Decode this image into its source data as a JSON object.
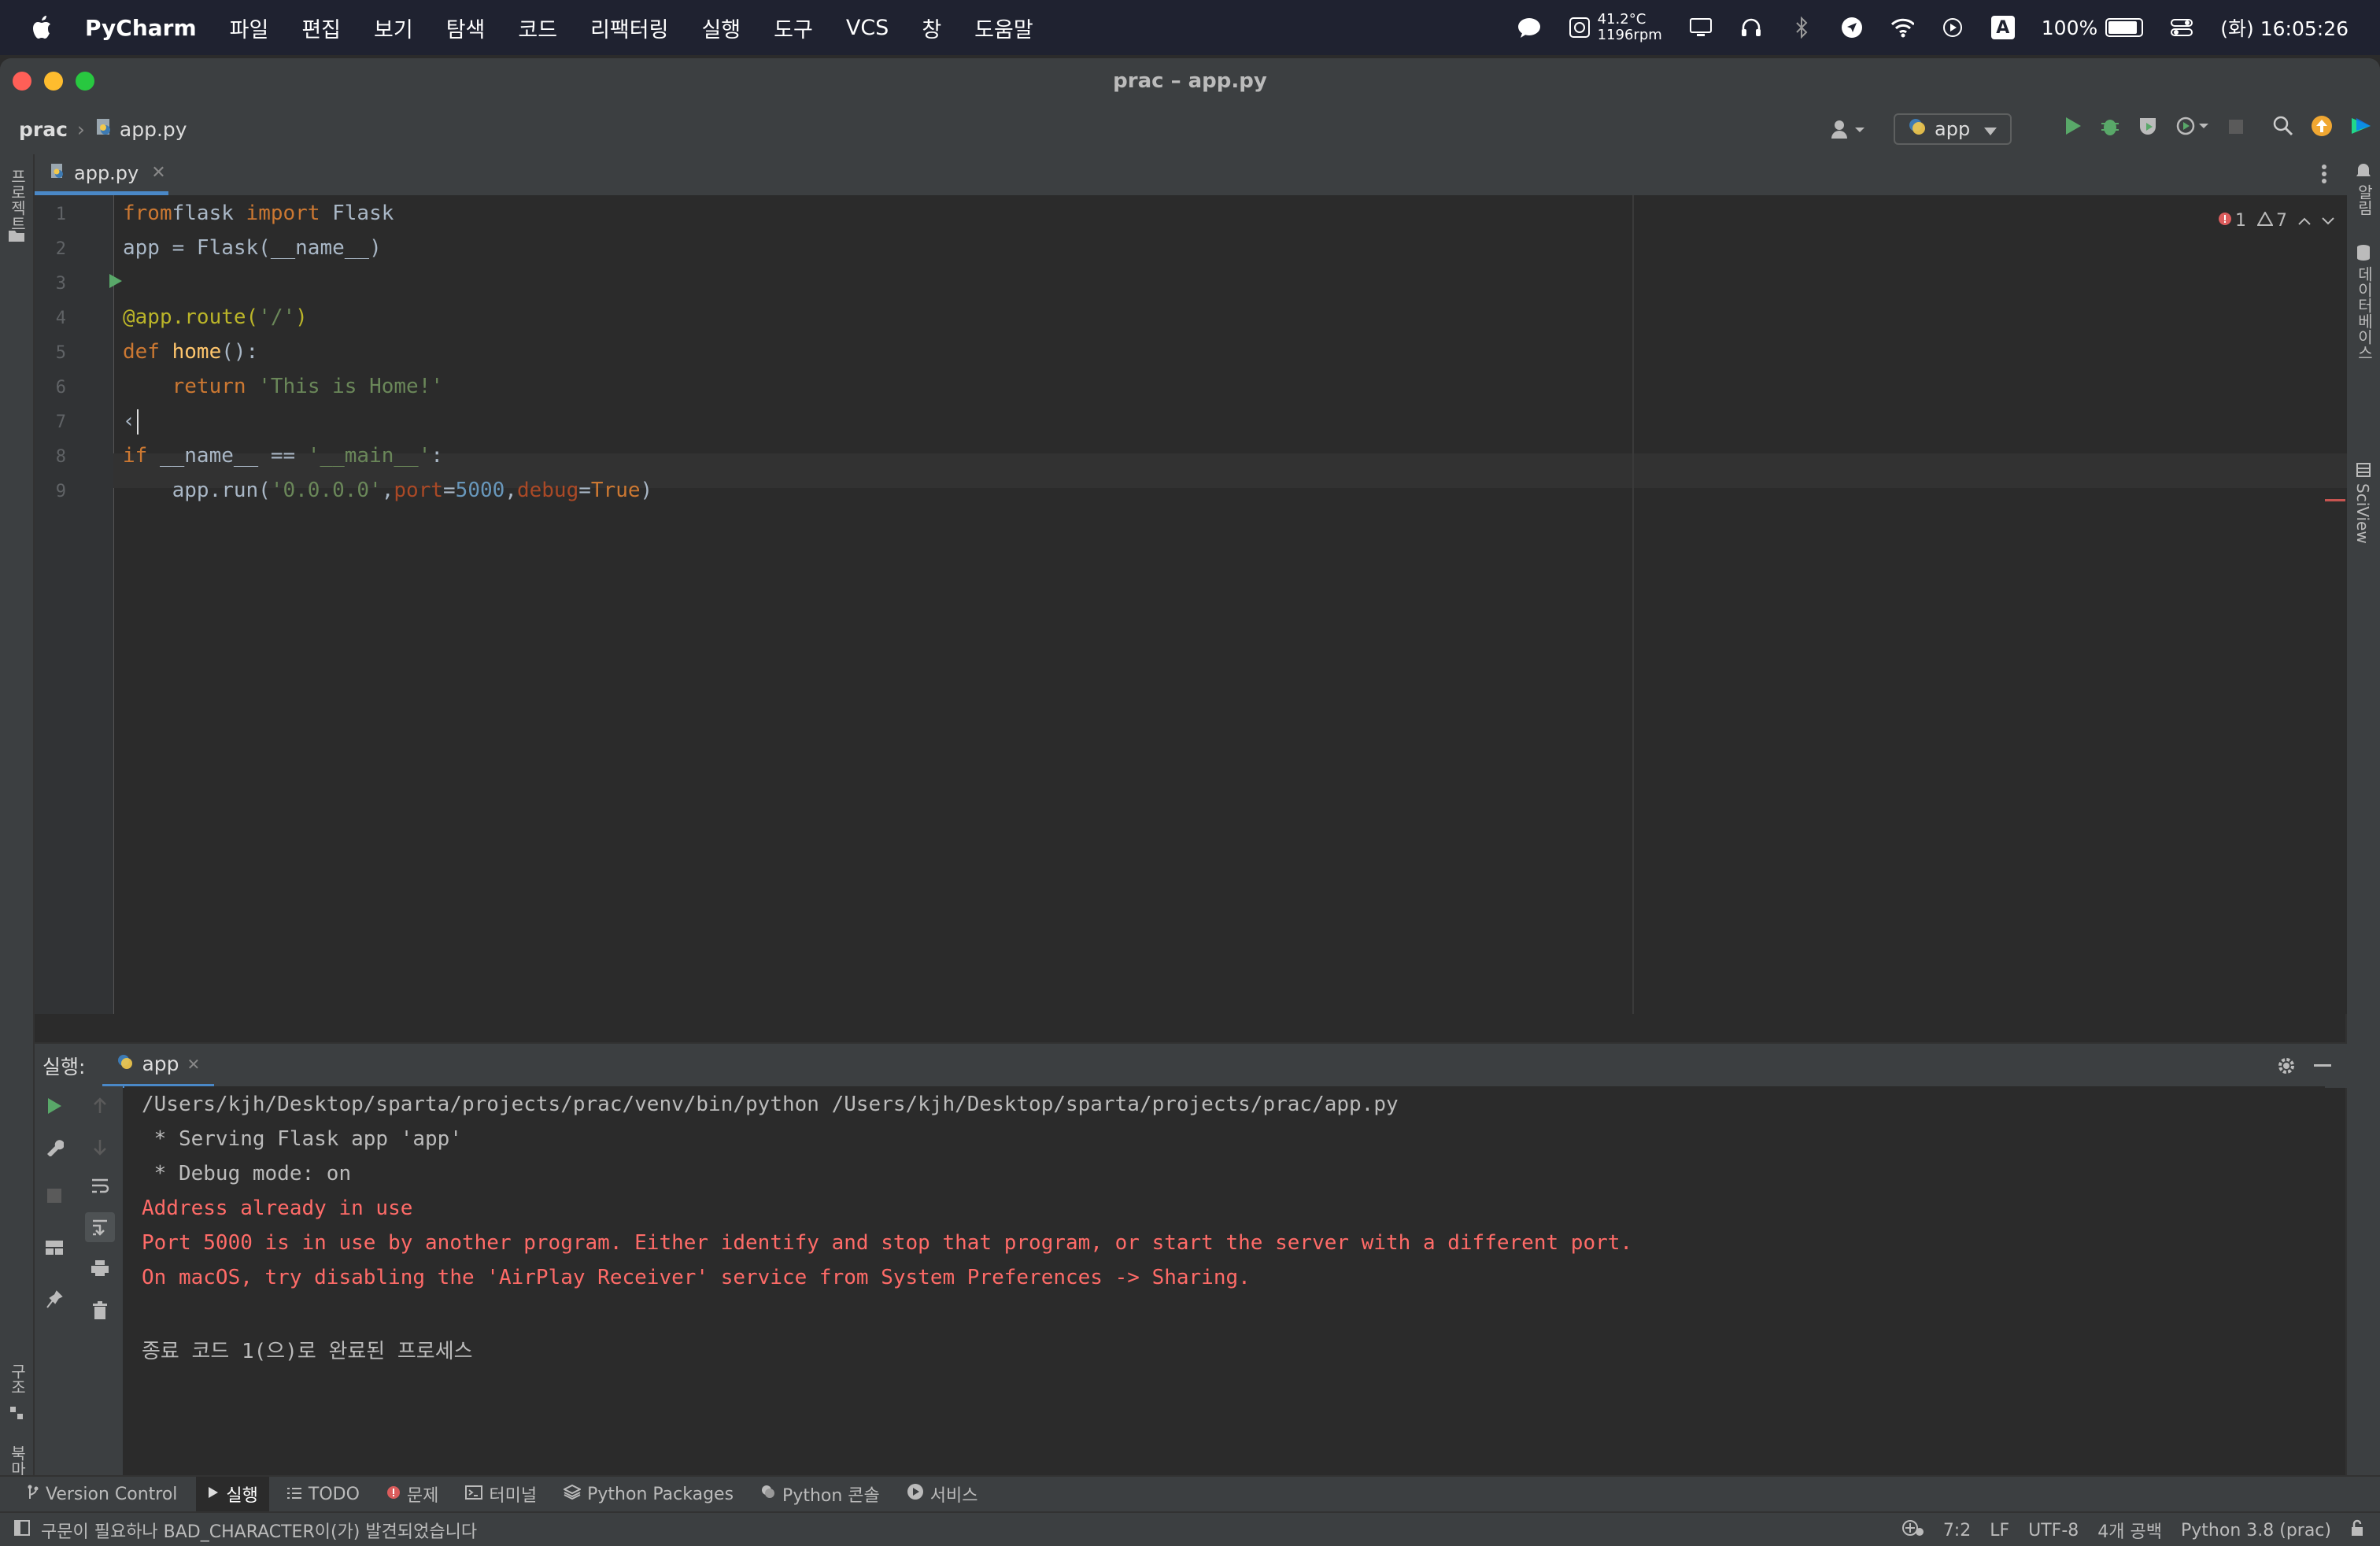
{
  "menubar": {
    "app_name": "PyCharm",
    "items": [
      "파일",
      "편집",
      "보기",
      "탐색",
      "코드",
      "리팩터링",
      "실행",
      "도구",
      "VCS",
      "창",
      "도움말"
    ],
    "temp": "41.2°C",
    "fan": "1196rpm",
    "input_source": "A",
    "battery": "100%",
    "datetime": "(화) 16:05:26"
  },
  "window": {
    "title": "prac – app.py"
  },
  "navbar": {
    "project": "prac",
    "file": "app.py",
    "run_config": "app"
  },
  "left_strip": {
    "project_label": "프로젝트",
    "structure_label": "구조",
    "bookmarks_label": "북마크"
  },
  "right_strip": {
    "notifications_label": "알림",
    "database_label": "데이터베이스",
    "sciview_label": "SciView"
  },
  "editor": {
    "tab": "app.py",
    "inspections": {
      "errors": "1",
      "warnings": "7"
    },
    "lines": [
      {
        "n": "1",
        "tokens": [
          [
            "kw",
            "from"
          ],
          [
            "",
            "flask "
          ],
          [
            "kw",
            "import"
          ],
          [
            "",
            " Flask"
          ]
        ]
      },
      {
        "n": "2",
        "tokens": [
          [
            "",
            "app = Flask(__name__)"
          ]
        ]
      },
      {
        "n": "3",
        "tokens": []
      },
      {
        "n": "4",
        "tokens": [
          [
            "deco",
            "@app.route("
          ],
          [
            "str",
            "'/'"
          ],
          [
            "deco",
            ")"
          ]
        ]
      },
      {
        "n": "5",
        "tokens": [
          [
            "kw",
            "def "
          ],
          [
            "fn",
            "home"
          ],
          [
            "",
            "():"
          ]
        ]
      },
      {
        "n": "6",
        "tokens": [
          [
            "",
            "    "
          ],
          [
            "kw",
            "return "
          ],
          [
            "str",
            "'This is Home!'"
          ]
        ]
      },
      {
        "n": "7",
        "tokens": [
          [
            "",
            "‹"
          ]
        ]
      },
      {
        "n": "8",
        "tokens": [
          [
            "kw",
            "if "
          ],
          [
            "",
            "__name__ == "
          ],
          [
            "str",
            "'__main__'"
          ],
          [
            "",
            ":"
          ]
        ]
      },
      {
        "n": "9",
        "tokens": [
          [
            "",
            "    app.run("
          ],
          [
            "str",
            "'0.0.0.0'"
          ],
          [
            "",
            ","
          ],
          [
            "param",
            "port"
          ],
          [
            "",
            "="
          ],
          [
            "num",
            "5000"
          ],
          [
            "",
            ","
          ],
          [
            "param",
            "debug"
          ],
          [
            "",
            "="
          ],
          [
            "kw",
            "True"
          ],
          [
            "",
            ")"
          ]
        ]
      }
    ]
  },
  "run_panel": {
    "label": "실행:",
    "tab": "app",
    "console": [
      {
        "style": "out",
        "text": "/Users/kjh/Desktop/sparta/projects/prac/venv/bin/python /Users/kjh/Desktop/sparta/projects/prac/app.py"
      },
      {
        "style": "out",
        "text": " * Serving Flask app 'app'"
      },
      {
        "style": "out",
        "text": " * Debug mode: on"
      },
      {
        "style": "err",
        "text": "Address already in use"
      },
      {
        "style": "err",
        "text": "Port 5000 is in use by another program. Either identify and stop that program, or start the server with a different port."
      },
      {
        "style": "err",
        "text": "On macOS, try disabling the 'AirPlay Receiver' service from System Preferences -> Sharing."
      },
      {
        "style": "out",
        "text": ""
      },
      {
        "style": "out",
        "text": "종료 코드 1(으)로 완료된 프로세스"
      }
    ]
  },
  "bottom_tools": {
    "version_control": "Version Control",
    "run": "실행",
    "todo": "TODO",
    "problems": "문제",
    "terminal": "터미널",
    "python_packages": "Python Packages",
    "python_console": "Python 콘솔",
    "services": "서비스"
  },
  "statusbar": {
    "message": "구문이 필요하나 BAD_CHARACTER이(가) 발견되었습니다",
    "position": "7:2",
    "line_sep": "LF",
    "encoding": "UTF-8",
    "indent": "4개 공백",
    "interpreter": "Python 3.8 (prac)"
  },
  "colors": {
    "accent": "#4a88c7",
    "error": "#ff6b68",
    "run_green": "#59a869"
  }
}
